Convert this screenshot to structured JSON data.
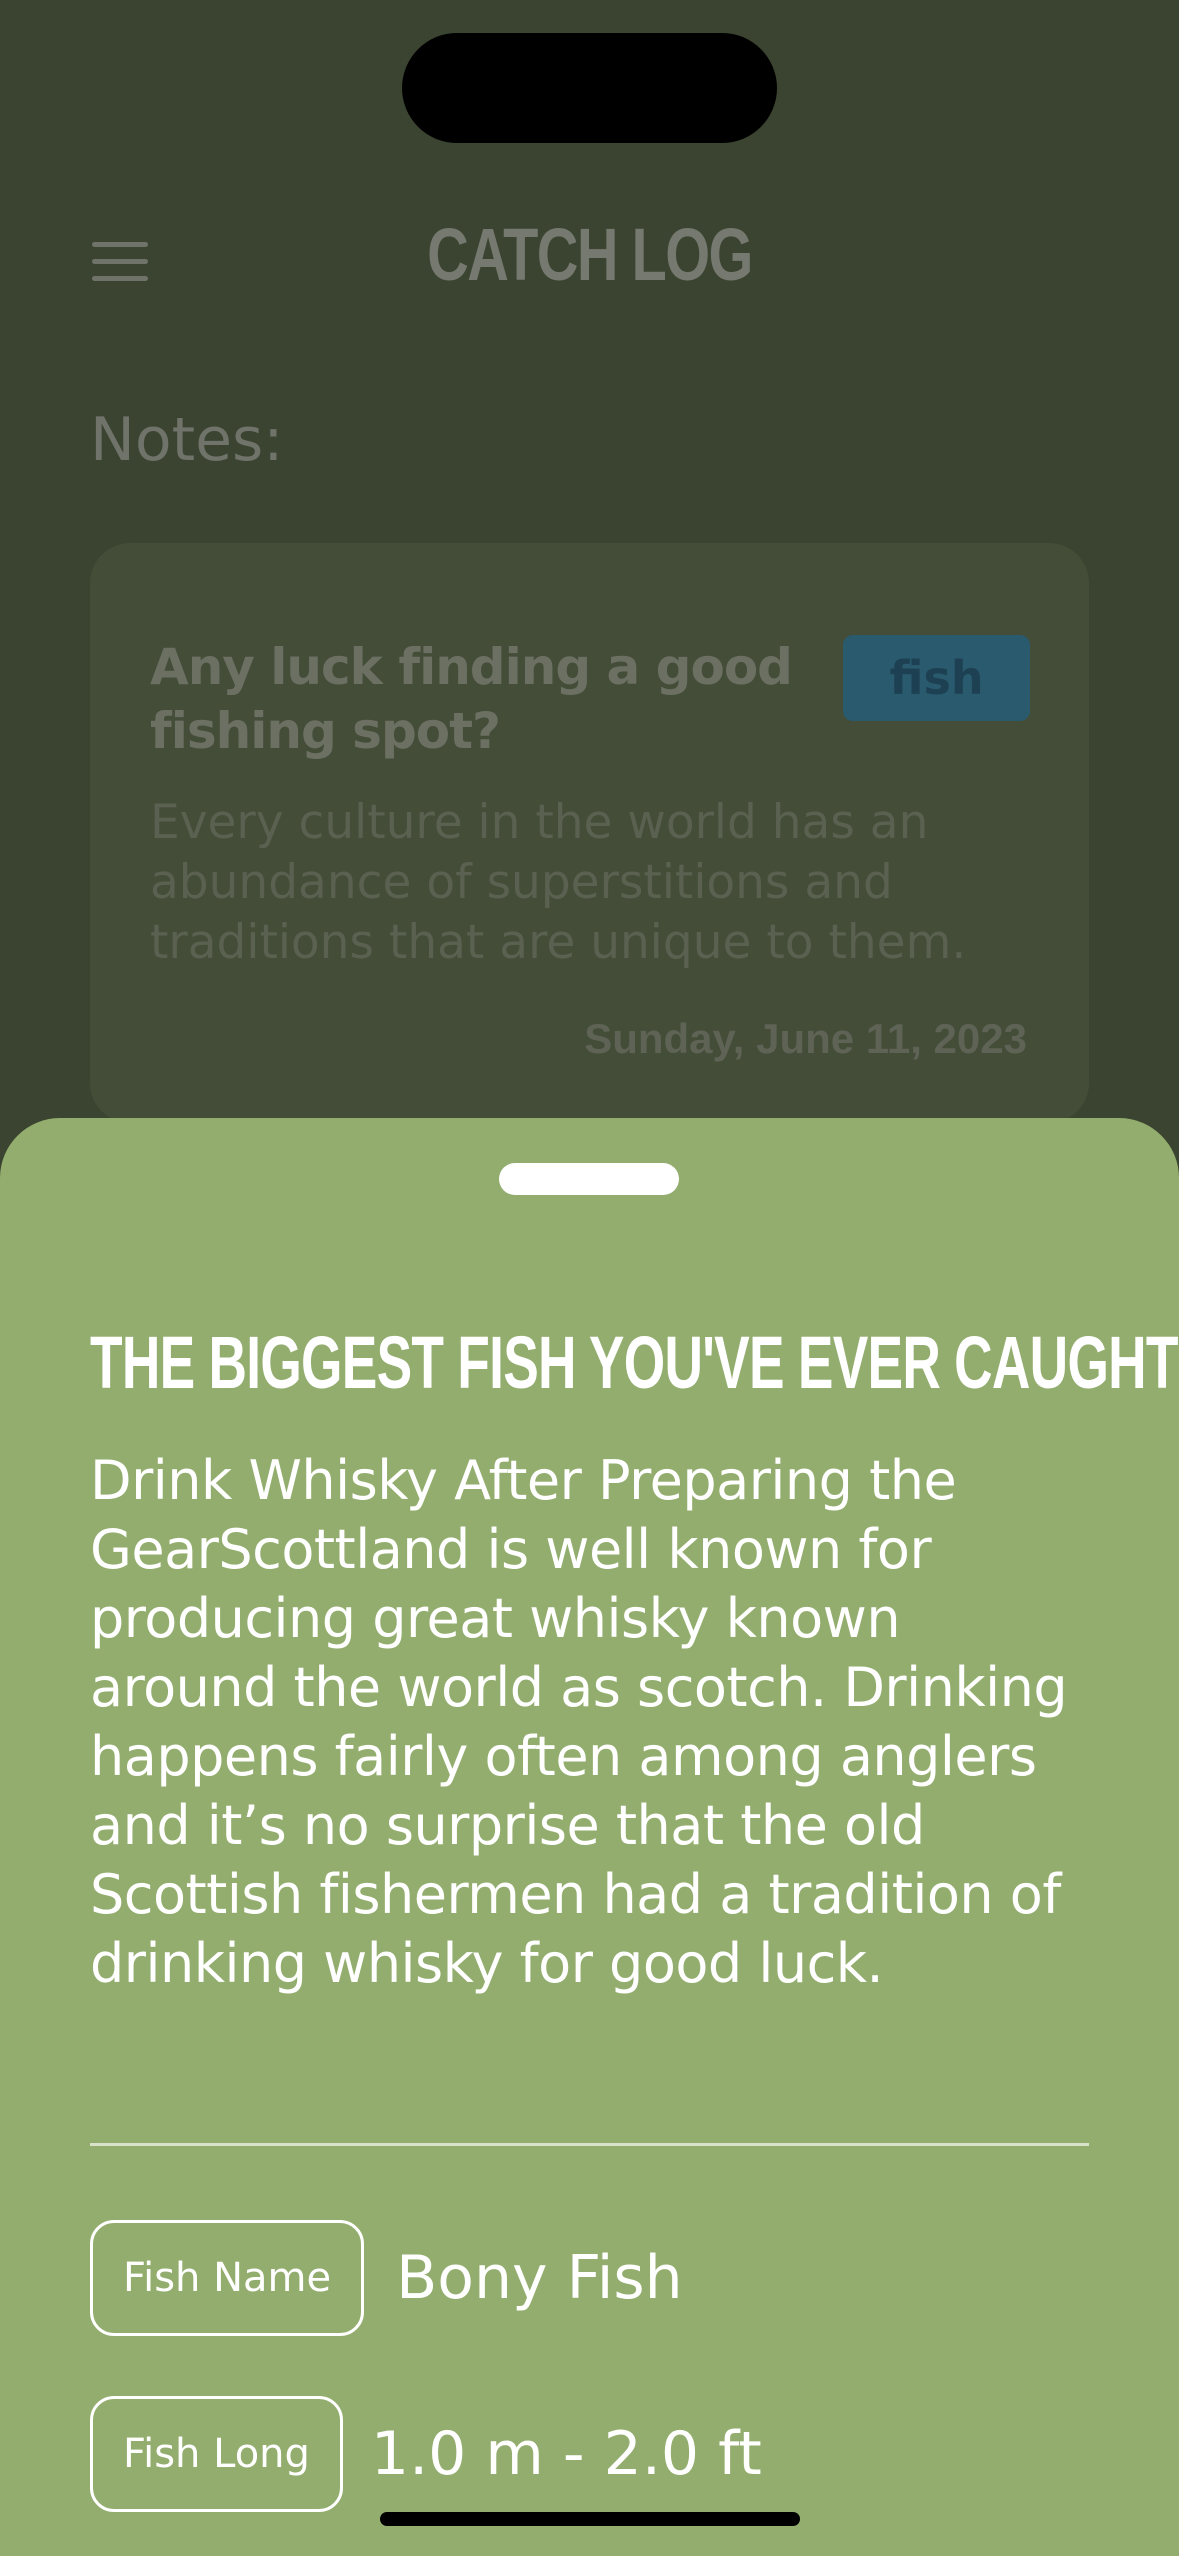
{
  "header": {
    "title": "CATCH LOG",
    "menu_icon": "hamburger-menu-icon"
  },
  "notes": {
    "label": "Notes:",
    "card": {
      "title": "Any luck finding a good fishing spot?",
      "tag": "fish",
      "body": "Every culture in the world has an abundance of superstitions and traditions that are unique to them.",
      "date": "Sunday, June 11, 2023"
    }
  },
  "sheet": {
    "title": "THE BIGGEST FISH YOU'VE EVER CAUGHT",
    "body": "Drink Whisky After Preparing the GearScottland is well known for producing great whisky known around the world as scotch. Drinking happens fairly often among anglers and it’s no surprise that the old Scottish fishermen had a tradition of drinking whisky for good luck.",
    "fields": [
      {
        "label": "Fish Name",
        "value": "Bony Fish"
      },
      {
        "label": "Fish Long",
        "value": "1.0 m - 2.0 ft"
      }
    ]
  },
  "colors": {
    "background_dimmed": "#3a4430",
    "sheet": "#93ad6e",
    "tag": "#2a5a6e",
    "text_on_sheet": "#ffffff"
  }
}
